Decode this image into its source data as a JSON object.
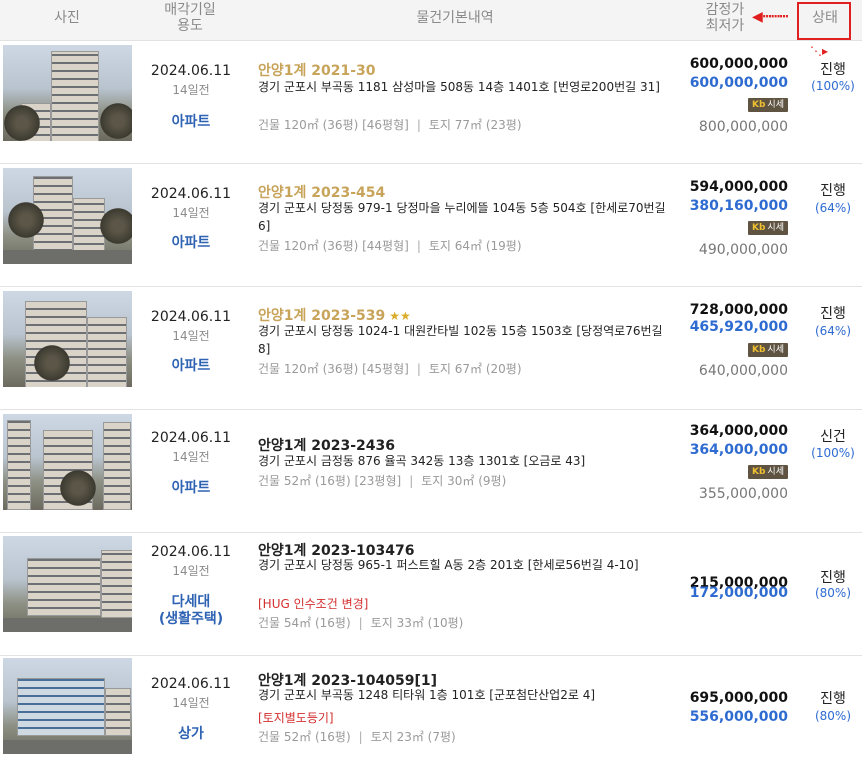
{
  "header": {
    "photo": "사진",
    "date_line1": "매각기일",
    "date_line2": "용도",
    "info": "물건기본내역",
    "price_line1": "감정가",
    "price_line2": "최저가",
    "status": "상태"
  },
  "rows": [
    {
      "date": "2024.06.11",
      "ago": "14일전",
      "usage": "아파트",
      "case": "안양1계 2021-30",
      "addr": "경기 군포시 부곡동 1181 삼성마을 508동 14층 1401호 [번영로200번길 31]",
      "building": "건물 120㎡ (36평) [46평형]",
      "land": "토지 77㎡ (23평)",
      "appraisal": "600,000,000",
      "minimum": "600,000,000",
      "sise_label": "시세",
      "market": "800,000,000",
      "status": "진행",
      "percent": "(100%)"
    },
    {
      "date": "2024.06.11",
      "ago": "14일전",
      "usage": "아파트",
      "case": "안양1계 2023-454",
      "addr": "경기 군포시 당정동 979-1 당정마을 누리에뜰 104동 5층 504호 [한세로70번길 6]",
      "building": "건물 120㎡ (36평) [44평형]",
      "land": "토지 64㎡ (19평)",
      "appraisal": "594,000,000",
      "minimum": "380,160,000",
      "sise_label": "시세",
      "market": "490,000,000",
      "status": "진행",
      "percent": "(64%)"
    },
    {
      "date": "2024.06.11",
      "ago": "14일전",
      "usage": "아파트",
      "case": "안양1계 2023-539",
      "stars": "★★",
      "addr": "경기 군포시 당정동 1024-1 대원칸타빌 102동 15층 1503호 [당정역로76번길 8]",
      "building": "건물 120㎡ (36평) [45평형]",
      "land": "토지 67㎡ (20평)",
      "appraisal": "728,000,000",
      "minimum": "465,920,000",
      "sise_label": "시세",
      "market": "640,000,000",
      "status": "진행",
      "percent": "(64%)"
    },
    {
      "date": "2024.06.11",
      "ago": "14일전",
      "usage": "아파트",
      "case": "안양1계 2023-2436",
      "addr": "경기 군포시 금정동 876 율곡 342동 13층 1301호 [오금로 43]",
      "building": "건물 52㎡ (16평) [23평형]",
      "land": "토지 30㎡ (9평)",
      "appraisal": "364,000,000",
      "minimum": "364,000,000",
      "sise_label": "시세",
      "market": "355,000,000",
      "status": "신건",
      "percent": "(100%)"
    },
    {
      "date": "2024.06.11",
      "ago": "14일전",
      "usage": "다세대\n(생활주택)",
      "case": "안양1계 2023-103476",
      "addr": "경기 군포시 당정동 965-1 퍼스트힐 A동 2층 201호 [한세로56번길 4-10]",
      "note": "[HUG 인수조건 변경]",
      "building": "건물 54㎡ (16평)",
      "land": "토지 33㎡ (10평)",
      "appraisal": "215,000,000",
      "minimum": "172,000,000",
      "status": "진행",
      "percent": "(80%)"
    },
    {
      "date": "2024.06.11",
      "ago": "14일전",
      "usage": "상가",
      "case": "안양1계 2023-104059[1]",
      "addr": "경기 군포시 부곡동 1248 티타워 1층 101호 [군포첨단산업2로 4]",
      "note": "[토지별도등기]",
      "building": "건물 52㎡ (16평)",
      "land": "토지 23㎡ (7평)",
      "appraisal": "695,000,000",
      "minimum": "556,000,000",
      "status": "진행",
      "percent": "(80%)"
    }
  ],
  "icons": {
    "arrow_left": "arrow-left-icon",
    "arrow_down": "arrow-down-icon",
    "kb": "kb-icon"
  },
  "colors": {
    "accent_blue": "#2e6bd1",
    "case_gold": "#c8a45a",
    "highlight_red": "#e02020"
  }
}
